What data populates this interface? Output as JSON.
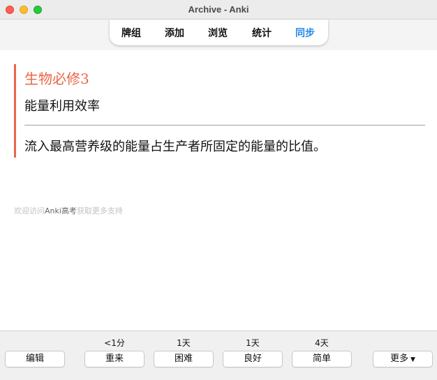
{
  "window": {
    "title": "Archive - Anki"
  },
  "toolbar": {
    "items": [
      "牌组",
      "添加",
      "浏览",
      "统计",
      "同步"
    ],
    "active_item": "同步"
  },
  "card": {
    "deck_title": "生物必修3",
    "front": "能量利用效率",
    "back": "流入最高营养级的能量占生产者所固定的能量的比值。"
  },
  "promo": {
    "prefix": "欢迎访问",
    "link": "Anki高考",
    "suffix": "获取更多支持"
  },
  "bottom": {
    "edit_label": "编辑",
    "answers": [
      {
        "interval": "<1分",
        "label": "重来"
      },
      {
        "interval": "1天",
        "label": "困难"
      },
      {
        "interval": "1天",
        "label": "良好"
      },
      {
        "interval": "4天",
        "label": "简单"
      }
    ],
    "more_label": "更多",
    "more_icon": "caret-down-icon"
  },
  "colors": {
    "accent": "#ea6545",
    "sync": "#1e88e5",
    "card_border": "#e8664d"
  }
}
